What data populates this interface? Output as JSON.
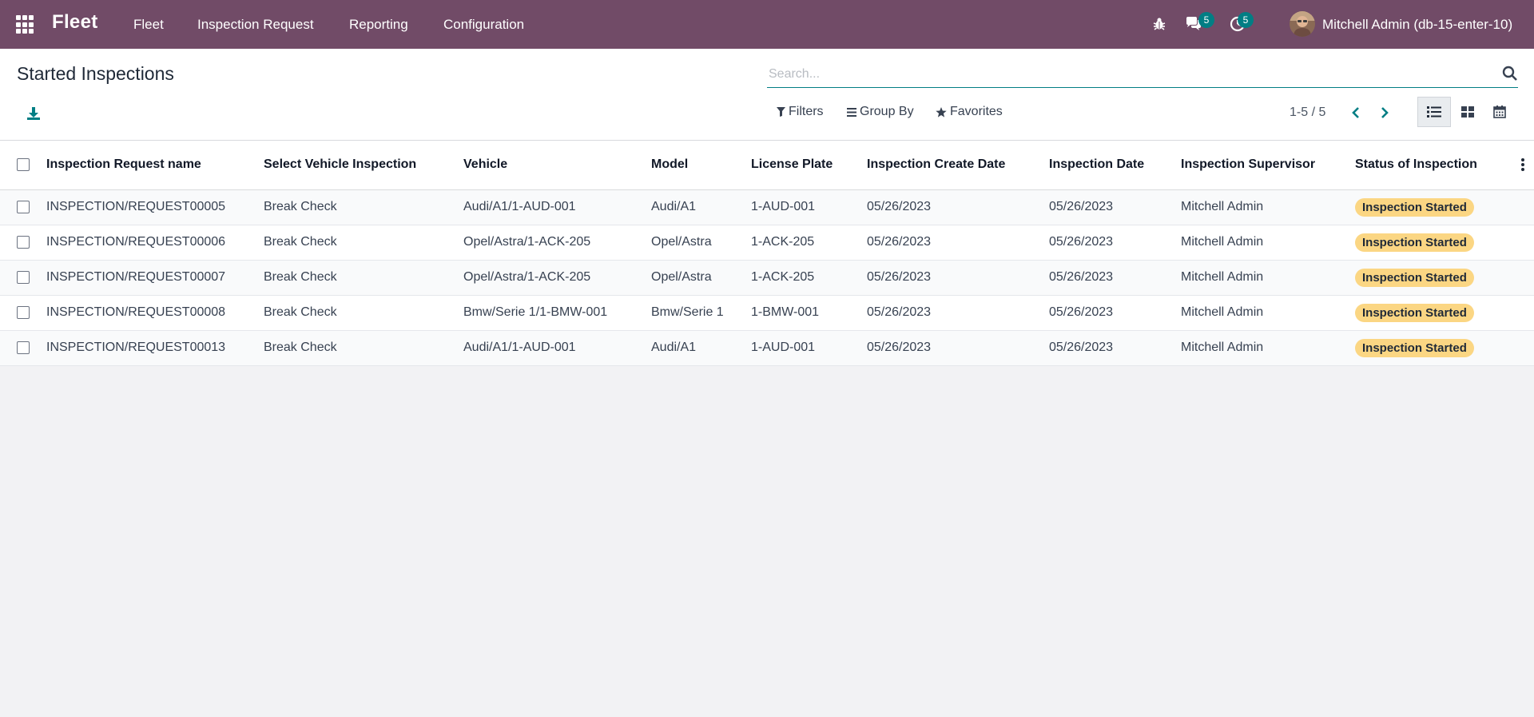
{
  "navbar": {
    "brand": "Fleet",
    "menu": [
      "Fleet",
      "Inspection Request",
      "Reporting",
      "Configuration"
    ],
    "messages_count": "5",
    "activities_count": "5",
    "user_name": "Mitchell Admin (db-15-enter-10)",
    "bg_color": "#714b67",
    "icons": [
      "apps-grid-icon",
      "bug-icon",
      "chat-icon",
      "clock-icon",
      "avatar"
    ]
  },
  "control_panel": {
    "title": "Started Inspections",
    "search_placeholder": "Search...",
    "filters_label": "Filters",
    "group_by_label": "Group By",
    "favorites_label": "Favorites",
    "pager": "1-5 / 5",
    "accent_color": "#017e84"
  },
  "table": {
    "columns": [
      "Inspection Request name",
      "Select Vehicle Inspection",
      "Vehicle",
      "Model",
      "License Plate",
      "Inspection Create Date",
      "Inspection Date",
      "Inspection Supervisor",
      "Status of Inspection"
    ],
    "rows": [
      {
        "name": "INSPECTION/REQUEST00005",
        "inspection": "Break Check",
        "vehicle": "Audi/A1/1-AUD-001",
        "model": "Audi/A1",
        "plate": "1-AUD-001",
        "create_date": "05/26/2023",
        "date": "05/26/2023",
        "supervisor": "Mitchell Admin",
        "status": "Inspection Started"
      },
      {
        "name": "INSPECTION/REQUEST00006",
        "inspection": "Break Check",
        "vehicle": "Opel/Astra/1-ACK-205",
        "model": "Opel/Astra",
        "plate": "1-ACK-205",
        "create_date": "05/26/2023",
        "date": "05/26/2023",
        "supervisor": "Mitchell Admin",
        "status": "Inspection Started"
      },
      {
        "name": "INSPECTION/REQUEST00007",
        "inspection": "Break Check",
        "vehicle": "Opel/Astra/1-ACK-205",
        "model": "Opel/Astra",
        "plate": "1-ACK-205",
        "create_date": "05/26/2023",
        "date": "05/26/2023",
        "supervisor": "Mitchell Admin",
        "status": "Inspection Started"
      },
      {
        "name": "INSPECTION/REQUEST00008",
        "inspection": "Break Check",
        "vehicle": "Bmw/Serie 1/1-BMW-001",
        "model": "Bmw/Serie 1",
        "plate": "1-BMW-001",
        "create_date": "05/26/2023",
        "date": "05/26/2023",
        "supervisor": "Mitchell Admin",
        "status": "Inspection Started"
      },
      {
        "name": "INSPECTION/REQUEST00013",
        "inspection": "Break Check",
        "vehicle": "Audi/A1/1-AUD-001",
        "model": "Audi/A1",
        "plate": "1-AUD-001",
        "create_date": "05/26/2023",
        "date": "05/26/2023",
        "supervisor": "Mitchell Admin",
        "status": "Inspection Started"
      }
    ],
    "status_color": "#fbd683"
  }
}
